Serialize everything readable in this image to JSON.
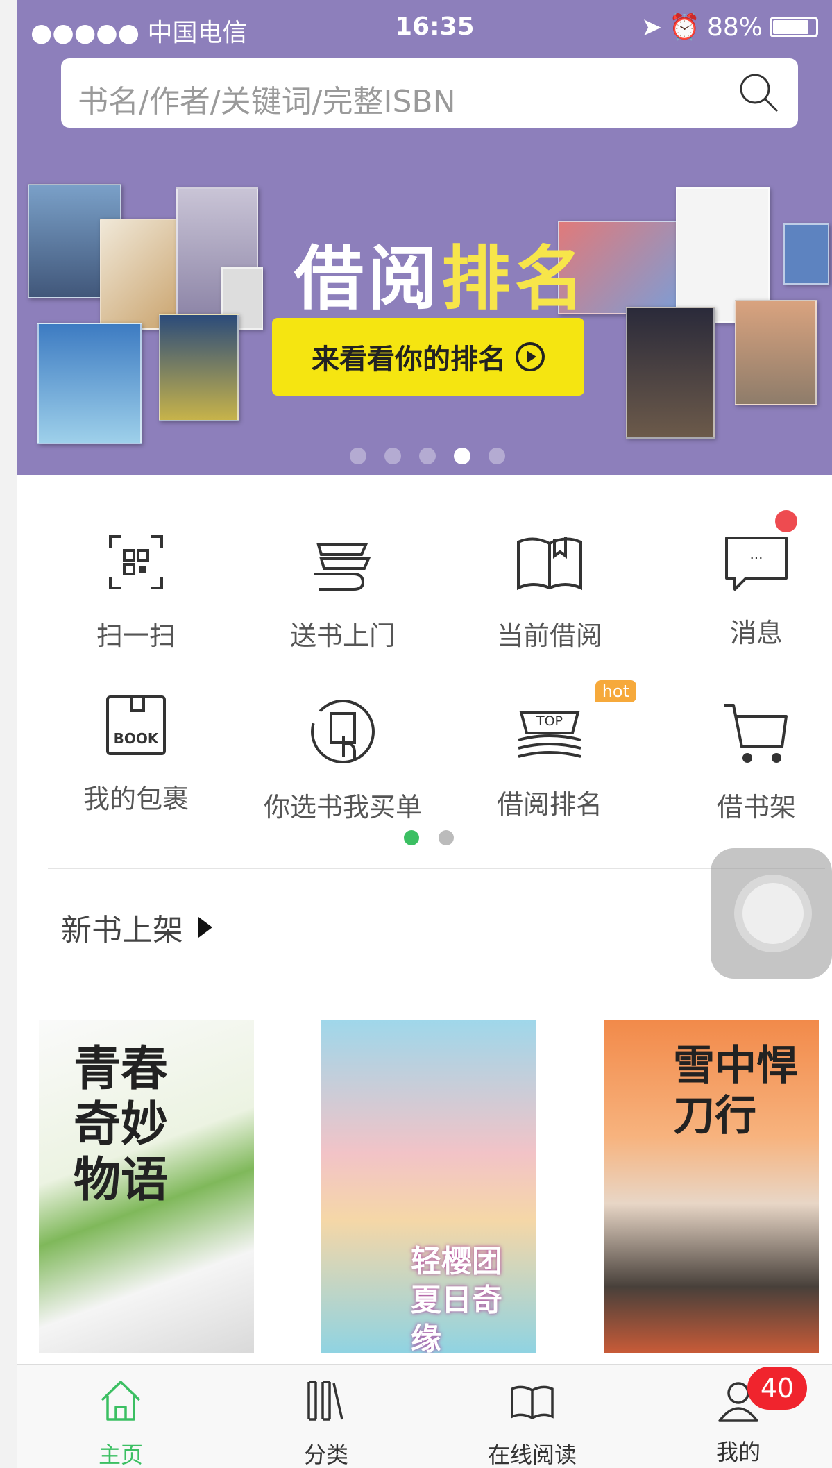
{
  "status_bar": {
    "carrier": "●●●●● 中国电信",
    "time": "16:35",
    "battery": "88%"
  },
  "search": {
    "placeholder": "书名/作者/关键词/完整ISBN",
    "icon": "search-icon"
  },
  "banner": {
    "title_white": "借阅",
    "title_yellow": "排名",
    "button_label": "来看看你的排名",
    "slide_count": 5,
    "active_slide": 4,
    "colors": {
      "background": "#8d7fbb",
      "accent": "#f5e511"
    }
  },
  "quick_actions": [
    {
      "label": "扫一扫",
      "icon": "qr-scan-icon"
    },
    {
      "label": "送书上门",
      "icon": "book-delivery-icon"
    },
    {
      "label": "当前借阅",
      "icon": "open-book-icon"
    },
    {
      "label": "消息",
      "icon": "message-icon",
      "has_dot": true
    },
    {
      "label": "我的包裹",
      "icon": "package-icon",
      "icon_text": "BOOK"
    },
    {
      "label": "你选书我买单",
      "icon": "select-book-icon"
    },
    {
      "label": "借阅排名",
      "icon": "ranking-icon",
      "icon_text": "TOP",
      "tag": "hot"
    },
    {
      "label": "借书架",
      "icon": "cart-icon"
    }
  ],
  "quick_pager": {
    "pages": 2,
    "active": 1
  },
  "new_books": {
    "title": "新书上架",
    "covers": [
      {
        "title": "青春奇妙物语"
      },
      {
        "title": "轻樱团夏日奇缘"
      },
      {
        "title": "雪中悍刀行"
      }
    ]
  },
  "tabs": [
    {
      "label": "主页",
      "icon": "home-icon",
      "active": true
    },
    {
      "label": "分类",
      "icon": "category-icon"
    },
    {
      "label": "在线阅读",
      "icon": "online-reading-icon"
    },
    {
      "label": "我的",
      "icon": "profile-icon",
      "badge": "40"
    }
  ],
  "accent_color": "#3bbf62"
}
